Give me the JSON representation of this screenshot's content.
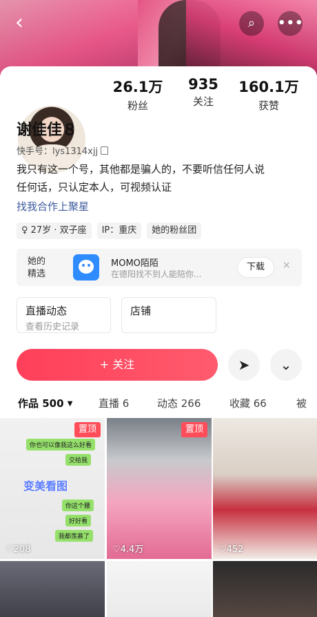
{
  "header": {
    "back_glyph": "‹",
    "search_glyph": "⌕",
    "more_glyph": "•••"
  },
  "profile": {
    "name": "谢佳佳８",
    "kuaishou_id": "快手号：lys1314xjj",
    "bio_line1": "我只有这一个号，其他都是骗人的，不要听信任何人说",
    "bio_line2": "任何话，只认定本人，可视频认证",
    "coop_link": "找我合作上聚星"
  },
  "stats": [
    {
      "num": "26.1万",
      "label": "粉丝"
    },
    {
      "num": "935",
      "label": "关注"
    },
    {
      "num": "160.1万",
      "label": "获赞"
    }
  ],
  "tags": {
    "age": "♀ 27岁 · 双子座",
    "ip": "IP：重庆",
    "fan_group": "她的粉丝团"
  },
  "ad": {
    "label_line1": "她的",
    "label_line2": "精选",
    "app_name": "MOMO陌陌",
    "subtitle": "在德阳找不到人能陪你...",
    "download": "下载",
    "close": "×",
    "brand_color": "#2e8cff"
  },
  "cards": {
    "live_title": "直播动态",
    "live_sub": "查看历史记录",
    "shop_title": "店铺"
  },
  "actions": {
    "follow": "+ 关注",
    "share_glyph": "➤",
    "expand_glyph": "⌄",
    "follow_color": "#ff3f59"
  },
  "tabs": [
    {
      "label": "作品 500"
    },
    {
      "label": "直播 6"
    },
    {
      "label": "动态 266"
    },
    {
      "label": "收藏 66"
    },
    {
      "label": "被"
    }
  ],
  "grid": {
    "pin_label": "置顶",
    "t1_likes": "♡208",
    "t2_likes": "♡4.4万",
    "t3_likes": "♡452",
    "watermark": "变美看图",
    "chat": [
      "你也可以像我这么好看",
      "交给我",
      "你这个腰",
      "好好看",
      "我都羡慕了"
    ]
  }
}
